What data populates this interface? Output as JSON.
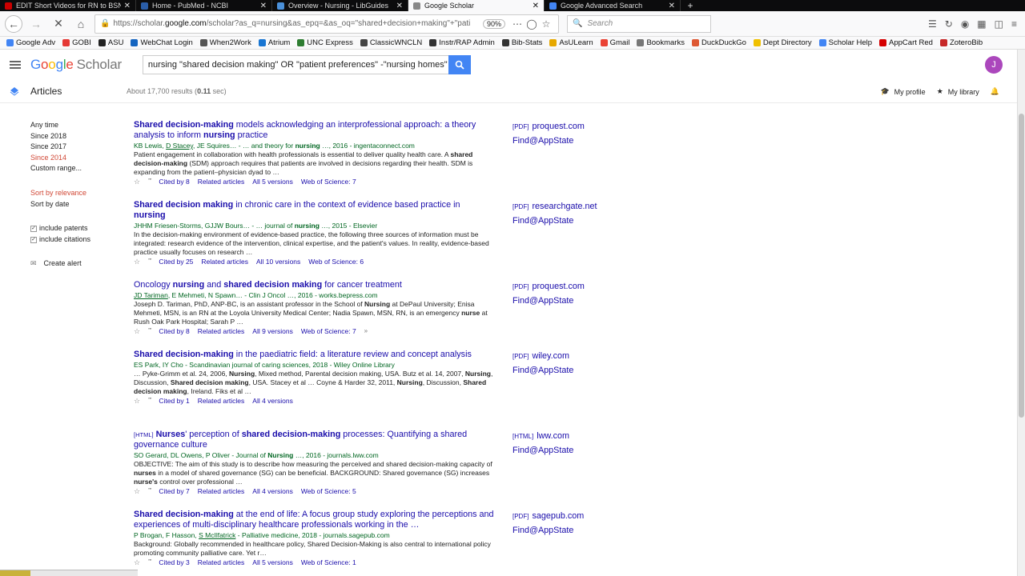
{
  "browser": {
    "tabs": [
      {
        "title": "EDIT Short Videos for RN to BSN St...",
        "icon_color": "#cc0000",
        "active": false
      },
      {
        "title": "Home - PubMed - NCBI",
        "icon_color": "#2a5da8",
        "active": false
      },
      {
        "title": "Overview - Nursing - LibGuides",
        "icon_color": "#4a90d9",
        "active": false
      },
      {
        "title": "Google Scholar",
        "icon_color": "#888888",
        "active": true
      },
      {
        "title": "Google Advanced Search",
        "icon_color": "#4285f4",
        "active": false
      }
    ],
    "new_tab_label": "+",
    "url_prefix": "https://scholar.",
    "url_domain": "google.com",
    "url_rest": "/scholar?as_q=nursing&as_epq=&as_oq=\"shared+decision+making\"+\"pati",
    "zoom": "90%",
    "search_placeholder": "Search",
    "bookmarks": [
      {
        "label": "Google Adv",
        "color": "#4285f4"
      },
      {
        "label": "GOBI",
        "color": "#e53935"
      },
      {
        "label": "ASU",
        "color": "#222222"
      },
      {
        "label": "WebChat Login",
        "color": "#1565c0"
      },
      {
        "label": "When2Work",
        "color": "#555555"
      },
      {
        "label": "Atrium",
        "color": "#1976d2"
      },
      {
        "label": "UNC Express",
        "color": "#2e7d32"
      },
      {
        "label": "ClassicWNCLN",
        "color": "#444444"
      },
      {
        "label": "Instr/RAP Admin",
        "color": "#333333"
      },
      {
        "label": "Bib-Stats",
        "color": "#333333"
      },
      {
        "label": "AsULearn",
        "color": "#e6a800"
      },
      {
        "label": "Gmail",
        "color": "#ea4335"
      },
      {
        "label": "Bookmarks",
        "color": "#777777"
      },
      {
        "label": "DuckDuckGo",
        "color": "#de5833"
      },
      {
        "label": "Dept Directory",
        "color": "#f0c000"
      },
      {
        "label": "Scholar Help",
        "color": "#4285f4"
      },
      {
        "label": "AppCart Red",
        "color": "#d50000"
      },
      {
        "label": "ZoteroBib",
        "color": "#c62828"
      }
    ]
  },
  "scholar": {
    "logo_parts": [
      "G",
      "o",
      "o",
      "g",
      "l",
      "e"
    ],
    "logo_suffix": "Scholar",
    "query": "nursing \"shared decision making\" OR \"patient preferences\" -\"nursing homes\"",
    "avatar_initial": "J",
    "section_label": "Articles",
    "stats_prefix": "About 17,700 results (",
    "stats_time": "0.11",
    "stats_suffix": " sec)",
    "my_profile": "My profile",
    "my_library": "My library",
    "sidebar": {
      "time_filters": [
        "Any time",
        "Since 2018",
        "Since 2017",
        "Since 2014",
        "Custom range..."
      ],
      "sort_options": [
        "Sort by relevance",
        "Sort by date"
      ],
      "include_patents": "include patents",
      "include_citations": "include citations",
      "create_alert": "Create alert"
    },
    "results": [
      {
        "tag": "",
        "title_html": "<b>Shared decision-making</b> models acknowledging an interprofessional approach: a theory analysis to inform <b>nursing</b> practice",
        "authors_html": "KB Lewis, <u>D Stacey</u>, JE Squires… - … and theory for <b>nursing</b> …, 2016 - ingentaconnect.com",
        "snippet_html": "Patient engagement in collaboration with health professionals is essential to deliver quality health care. A <b>shared decision-making</b> (SDM) approach requires that patients are involved in decisions regarding their health. SDM is expanding from the patient–physician dyad to …",
        "cited": "Cited by 8",
        "related": "Related articles",
        "versions": "All 5 versions",
        "wos": "Web of Science: 7",
        "side_type": "[PDF]",
        "side_source": "proquest.com",
        "side_find": "Find@AppState"
      },
      {
        "tag": "",
        "title_html": "<b>Shared decision making</b> in chronic care in the context of evidence based practice in <b>nursing</b>",
        "authors_html": "JHHM Friesen-Storms, GJJW Bours… - … journal of <b>nursing</b> …, 2015 - Elsevier",
        "snippet_html": "In the decision-making environment of evidence-based practice, the following three sources of information must be integrated: research evidence of the intervention, clinical expertise, and the patient's values. In reality, evidence-based practice usually focuses on research …",
        "cited": "Cited by 25",
        "related": "Related articles",
        "versions": "All 10 versions",
        "wos": "Web of Science: 6",
        "side_type": "[PDF]",
        "side_source": "researchgate.net",
        "side_find": "Find@AppState"
      },
      {
        "tag": "",
        "title_html": "Oncology <b>nursing</b> and <b>shared decision making</b> for cancer treatment",
        "authors_html": "<u>JD Tariman</u>, E Mehmeti, N Spawn… - Clin J Oncol …, 2016 - works.bepress.com",
        "snippet_html": "Joseph D. Tariman, PhD, ANP-BC, is an assistant professor in the School of <b>Nursing</b> at DePaul University; Enisa Mehmeti, MSN, is an RN at the Loyola University Medical Center; Nadia Spawn, MSN, RN, is an emergency <b>nurse</b> at Rush Oak Park Hospital; Sarah P …",
        "cited": "Cited by 8",
        "related": "Related articles",
        "versions": "All 9 versions",
        "wos": "Web of Science: 7",
        "side_type": "[PDF]",
        "side_source": "proquest.com",
        "side_find": "Find@AppState"
      },
      {
        "tag": "",
        "title_html": "<b>Shared decision-making</b> in the paediatric field: a literature review and concept analysis",
        "authors_html": "ES Park, IY Cho - Scandinavian journal of caring sciences, 2018 - Wiley Online Library",
        "snippet_html": "… Pyke-Grimm et al. 24, 2006, <b>Nursing</b>, Mixed method, Parental decision making, USA. Butz et al. 14, 2007, <b>Nursing</b>, Discussion, <b>Shared decision making</b>, USA. Stacey et al … Coyne &amp; Harder 32, 2011, <b>Nursing</b>, Discussion, <b>Shared decision making</b>, Ireland. Fiks et al …",
        "cited": "Cited by 1",
        "related": "Related articles",
        "versions": "All 4 versions",
        "wos": "",
        "side_type": "[PDF]",
        "side_source": "wiley.com",
        "side_find": "Find@AppState"
      },
      {
        "tag": "[HTML]",
        "title_html": "<b>Nurses</b>' perception of <b>shared decision-making</b> processes: Quantifying a shared governance culture",
        "authors_html": "SO Gerard, DL Owens, P Oliver - Journal of <b>Nursing</b> …, 2016 - journals.lww.com",
        "snippet_html": "OBJECTIVE: The aim of this study is to describe how measuring the perceived and shared decision-making capacity of <b>nurses</b> in a model of shared governance (SG) can be beneficial. BACKGROUND: Shared governance (SG) increases <b>nurse's</b> control over professional …",
        "cited": "Cited by 7",
        "related": "Related articles",
        "versions": "All 4 versions",
        "wos": "Web of Science: 5",
        "side_type": "[HTML]",
        "side_source": "lww.com",
        "side_find": "Find@AppState"
      },
      {
        "tag": "",
        "title_html": "<b>Shared decision-making</b> at the end of life: A focus group study exploring the perceptions and experiences of multi-disciplinary healthcare professionals working in the …",
        "authors_html": "P Brogan, F Hasson, <u>S McIlfatrick</u> - Palliative medicine, 2018 - journals.sagepub.com",
        "snippet_html": "Background: Globally recommended in healthcare policy, Shared Decision-Making is also central to international policy promoting community palliative care. Yet r…",
        "cited": "Cited by 3",
        "related": "Related articles",
        "versions": "All 5 versions",
        "wos": "Web of Science: 1",
        "side_type": "[PDF]",
        "side_source": "sagepub.com",
        "side_find": "Find@AppState"
      }
    ]
  }
}
